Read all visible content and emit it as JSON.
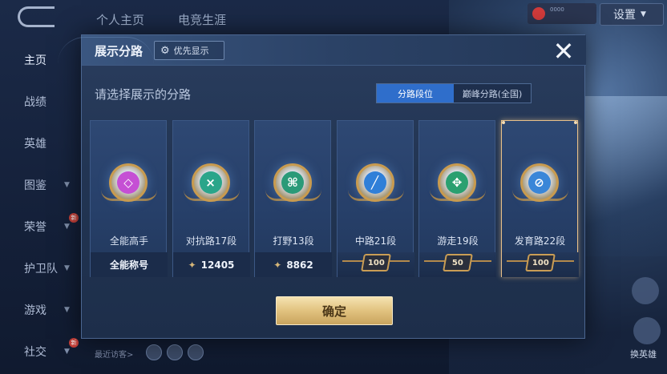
{
  "top_tabs": [
    "个人主页",
    "电竞生涯"
  ],
  "settings": {
    "label": "设置"
  },
  "live_badge": {
    "text": "0000"
  },
  "sidebar": {
    "items": [
      {
        "label": "主页",
        "active": true,
        "arrow": false
      },
      {
        "label": "战绩",
        "active": false,
        "arrow": false
      },
      {
        "label": "英雄",
        "active": false,
        "arrow": false
      },
      {
        "label": "图鉴",
        "active": false,
        "arrow": true
      },
      {
        "label": "荣誉",
        "active": false,
        "arrow": true
      },
      {
        "label": "护卫队",
        "active": false,
        "arrow": true
      },
      {
        "label": "游戏",
        "active": false,
        "arrow": true
      },
      {
        "label": "社交",
        "active": false,
        "arrow": true
      }
    ],
    "new_badge": "新"
  },
  "recent_visitors": {
    "label": "最近访客>"
  },
  "right_buttons": {
    "hero": "换英雄"
  },
  "modal": {
    "title": "展示分路",
    "priority_label": "优先显示",
    "close_label": "✕",
    "prompt": "请选择展示的分路",
    "tabs": [
      {
        "label": "分路段位",
        "active": true
      },
      {
        "label": "巅峰分路(全国)",
        "active": false
      }
    ],
    "cards": [
      {
        "label": "全能高手",
        "foot_type": "text",
        "foot": "全能称号",
        "color": "#c54fd4",
        "glyph": "◇",
        "selected": false
      },
      {
        "label": "对抗路17段",
        "foot_type": "score",
        "foot": "12405",
        "color": "#2aa58a",
        "glyph": "⨯",
        "selected": false
      },
      {
        "label": "打野13段",
        "foot_type": "score",
        "foot": "8862",
        "color": "#2a9a78",
        "glyph": "⌘",
        "selected": false
      },
      {
        "label": "中路21段",
        "foot_type": "badge",
        "foot": "100",
        "color": "#2f7fd8",
        "glyph": "╱",
        "selected": false
      },
      {
        "label": "游走19段",
        "foot_type": "badge",
        "foot": "50",
        "color": "#2aa070",
        "glyph": "✥",
        "selected": false
      },
      {
        "label": "发育路22段",
        "foot_type": "badge",
        "foot": "100",
        "color": "#3a86d8",
        "glyph": "⊘",
        "selected": true
      }
    ],
    "confirm_label": "确定"
  },
  "colors": {
    "accent_tab": "#2f6ecb",
    "selected_border": "#e7c08a",
    "confirm_gold": "#e1c27f"
  }
}
